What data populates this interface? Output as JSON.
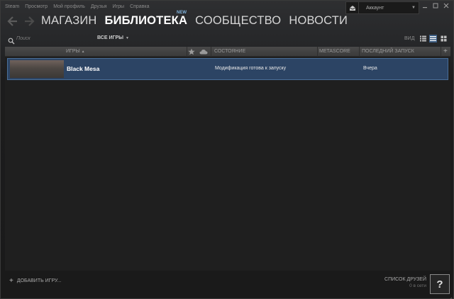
{
  "menu": [
    "Steam",
    "Просмотр",
    "Мой профиль",
    "Друзья",
    "Игры",
    "Справка"
  ],
  "account": {
    "name": "Аккаунт"
  },
  "nav": {
    "tabs": [
      {
        "label": "МАГАЗИН",
        "active": false
      },
      {
        "label": "БИБЛИОТЕКА",
        "active": true
      },
      {
        "label": "СООБЩЕСТВО",
        "active": false
      },
      {
        "label": "НОВОСТИ",
        "active": false
      }
    ],
    "new_badge": "NEW"
  },
  "library": {
    "search_placeholder": "Поиск",
    "filter_label": "ВСЕ ИГРЫ",
    "view_label": "ВИД"
  },
  "table": {
    "columns": {
      "games": "ИГРЫ",
      "status": "СОСТОЯНИЕ",
      "metascore": "METASCORE",
      "last_played": "ПОСЛЕДНИЙ ЗАПУСК"
    },
    "rows": [
      {
        "name": "Black Mesa",
        "status": "Модификация готова к запуску",
        "metascore": "",
        "last_played": "Вчера"
      }
    ]
  },
  "footer": {
    "add_game": "ДОБАВИТЬ ИГРУ...",
    "friends_list": "СПИСОК ДРУЗЕЙ",
    "friends_online": "0 в сети",
    "help": "?"
  },
  "colors": {
    "selection": "#2c4464",
    "accent": "#7fb1da",
    "background": "#1e1e1e"
  }
}
